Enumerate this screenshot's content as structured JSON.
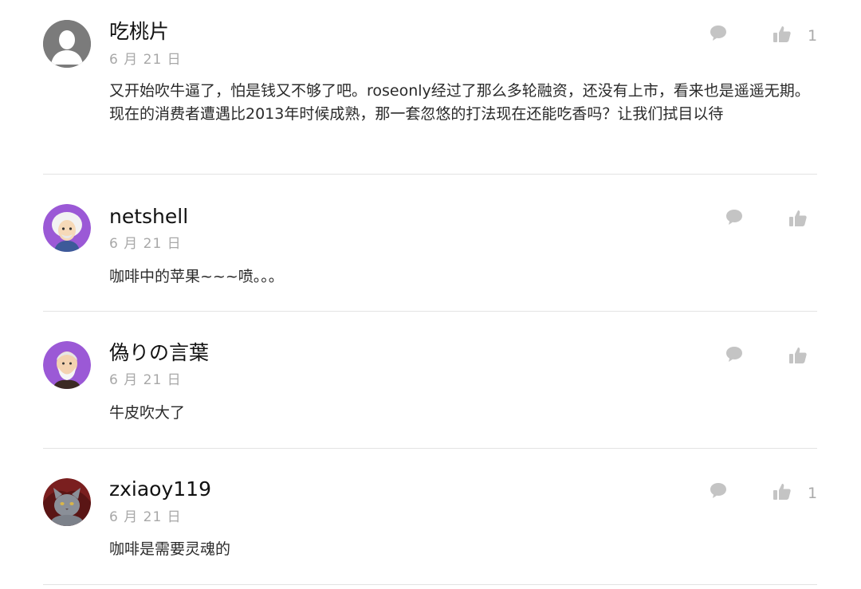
{
  "comments": [
    {
      "username": "吃桃片",
      "date": "6 月 21 日",
      "text": "又开始吹牛逼了，怕是钱又不够了吧。roseonly经过了那么多轮融资，还没有上市，看来也是遥遥无期。现在的消费者遭遇比2013年时候成熟，那一套忽悠的打法现在还能吃香吗？让我们拭目以待",
      "likes": "1",
      "avatar": "default-avatar"
    },
    {
      "username": "netshell",
      "date": "6 月 21 日",
      "text": "咖啡中的苹果~~~喷。。。",
      "likes": "",
      "avatar": "einstein-avatar"
    },
    {
      "username": "偽りの言葉",
      "date": "6 月 21 日",
      "text": "牛皮吹大了",
      "likes": "",
      "avatar": "old-man-avatar"
    },
    {
      "username": "zxiaoy119",
      "date": "6 月 21 日",
      "text": "咖啡是需要灵魂的",
      "likes": "1",
      "avatar": "cat-avatar"
    }
  ],
  "icons": {
    "reply": "speech-bubble-icon",
    "like": "thumbs-up-icon"
  },
  "colors": {
    "icon": "#c4c4c4",
    "date": "#a8a8a8",
    "avatar_purple": "#9b59d6",
    "divider": "#e3e3e3"
  }
}
